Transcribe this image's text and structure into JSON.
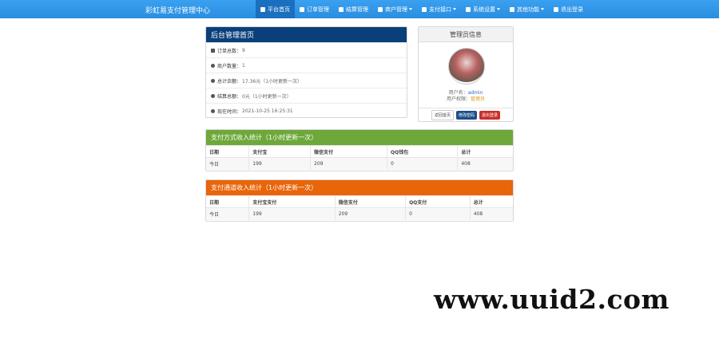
{
  "navbar": {
    "brand": "彩虹易支付管理中心",
    "items": [
      {
        "label": "平台首页",
        "icon": "home-icon",
        "active": true,
        "caret": false
      },
      {
        "label": "订单管理",
        "icon": "list-icon",
        "active": false,
        "caret": false
      },
      {
        "label": "结算管理",
        "icon": "cloud-icon",
        "active": false,
        "caret": false
      },
      {
        "label": "商户管理",
        "icon": "user-icon",
        "active": false,
        "caret": true
      },
      {
        "label": "支付接口",
        "icon": "card-icon",
        "active": false,
        "caret": true
      },
      {
        "label": "系统设置",
        "icon": "gear-icon",
        "active": false,
        "caret": true
      },
      {
        "label": "其他功能",
        "icon": "globe-icon",
        "active": false,
        "caret": true
      },
      {
        "label": "退出登录",
        "icon": "power-icon",
        "active": false,
        "caret": false
      }
    ],
    "accent_color": "#2a8ee0"
  },
  "home_panel": {
    "title": "后台管理首页",
    "rows": [
      {
        "label": "订单总数：",
        "value": "9",
        "icon": "bar-chart-icon"
      },
      {
        "label": "商户数量：",
        "value": "1",
        "icon": "drop-icon"
      },
      {
        "label": "总计余额：",
        "value": "17.36元（1小时更新一次）",
        "icon": "drop-icon"
      },
      {
        "label": "结算总额：",
        "value": "0元（1小时更新一次）",
        "icon": "drop-icon"
      },
      {
        "label": "现在时间：",
        "value": "2021-10-25 16:25:31",
        "icon": "clock-icon"
      }
    ]
  },
  "admin_panel": {
    "title": "管理员信息",
    "username_label": "用户名：",
    "username": "admin",
    "perm_label": "用户权限：",
    "perm": "管理员",
    "buttons": {
      "home": "返回首页",
      "password": "修改密码",
      "logout": "退出登录"
    }
  },
  "pay_method_table": {
    "title": "支付方式收入统计（1小时更新一次）",
    "headers": [
      "日期",
      "支付宝",
      "微信支付",
      "QQ钱包",
      "总计"
    ],
    "rows": [
      [
        "今日",
        "199",
        "209",
        "0",
        "408"
      ]
    ],
    "header_color": "#6ea83a"
  },
  "pay_channel_table": {
    "title": "支付通道收入统计（1小时更新一次）",
    "headers": [
      "日期",
      "支付宝支付",
      "微信支付",
      "QQ支付",
      "总计"
    ],
    "rows": [
      [
        "今日",
        "199",
        "209",
        "0",
        "408"
      ]
    ],
    "header_color": "#e8650a"
  },
  "watermark": "www.uuid2.com"
}
